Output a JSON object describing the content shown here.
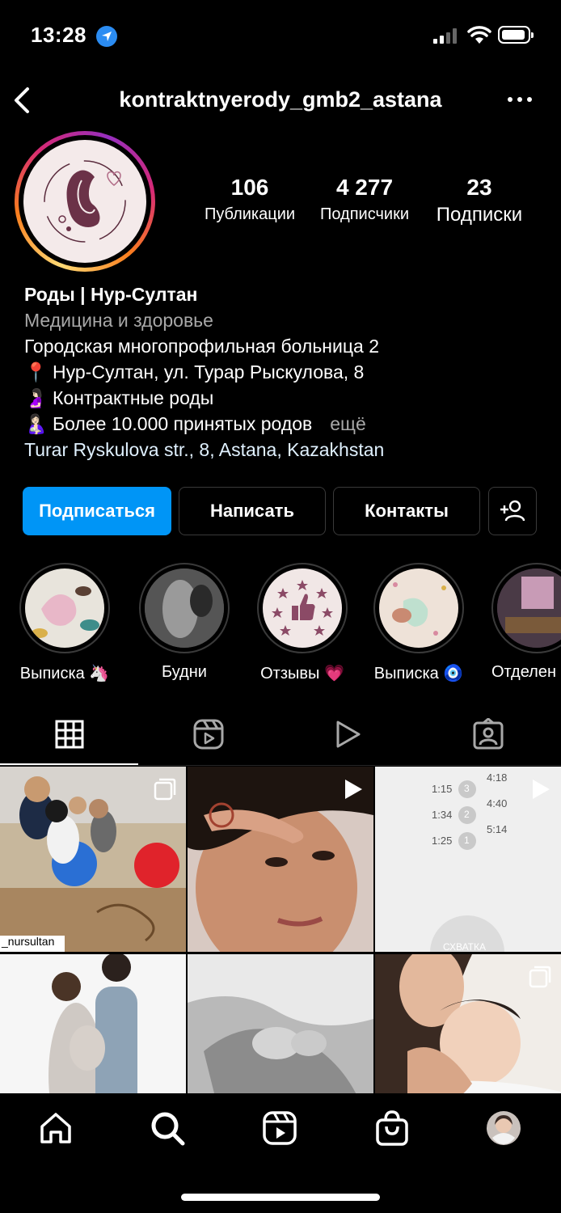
{
  "status_bar": {
    "time": "13:28"
  },
  "header": {
    "username": "kontraktnyerody_gmb2_astana"
  },
  "stats": [
    {
      "value": "106",
      "label": "Публикации"
    },
    {
      "value": "4 277",
      "label": "Подписчики"
    },
    {
      "value": "23",
      "label": "Подписки"
    }
  ],
  "bio": {
    "name": "Роды | Нур-Султан",
    "category": "Медицина и здоровье",
    "lines": [
      "Городская многопрофильная больница 2",
      "📍 Нур-Султан, ул. Турар Рыскулова, 8",
      "🤰🏻 Контрактные роды",
      "🤱🏻 Более 10.000 принятых родов"
    ],
    "more": "ещё",
    "address": "Turar Ryskulova str., 8, Astana, Kazakhstan"
  },
  "buttons": {
    "follow": "Подписаться",
    "message": "Написать",
    "contacts": "Контакты"
  },
  "highlights": [
    {
      "label": "Выписка 🦄"
    },
    {
      "label": "Будни"
    },
    {
      "label": "Отзывы 💗"
    },
    {
      "label": "Выписка 🧿"
    },
    {
      "label": "Отделен"
    }
  ],
  "posts": {
    "tile1_caption": "_nursultan",
    "tile3_times": [
      "1:15",
      "1:34",
      "1:25"
    ],
    "tile3_nums": [
      "3",
      "2",
      "1"
    ],
    "tile3_right_times": [
      "4:18",
      "4:40",
      "5:14"
    ],
    "tile3_overlay": "СХВАТКА"
  },
  "colors": {
    "accent": "#0095f6",
    "background": "#000000",
    "secondary_text": "#a8a8a8"
  }
}
